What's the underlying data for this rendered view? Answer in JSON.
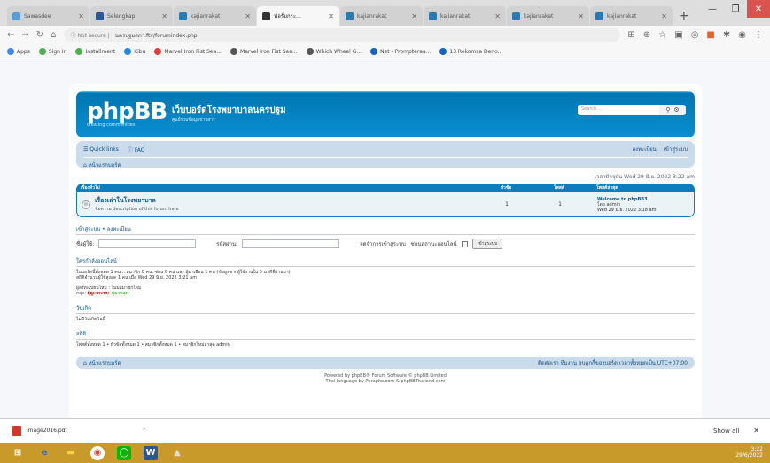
{
  "browser": {
    "tabs": [
      {
        "title": "Sawasdee",
        "color": "#5b9bd5"
      },
      {
        "title": "Selengkap",
        "color": "#2b5797"
      },
      {
        "title": "kajianrakat",
        "color": "#2a7ab0"
      },
      {
        "title": "ฟอรั่มกระ...",
        "color": "#333333",
        "active": true
      },
      {
        "title": "kajianrakat",
        "color": "#2a7ab0"
      },
      {
        "title": "kajianrakat",
        "color": "#2a7ab0"
      },
      {
        "title": "kajianrakat",
        "color": "#2a7ab0"
      },
      {
        "title": "kajianrakat",
        "color": "#2a7ab0"
      }
    ],
    "new_tab": "+",
    "address": "นครปฐมสภา.ftv/forumindex.php",
    "security": "ⓘ Not secure |",
    "bookmarks": [
      {
        "label": "Apps",
        "color": "#4285f4"
      },
      {
        "label": "Sign In",
        "color": "#4caf50"
      },
      {
        "label": "Installment",
        "color": "#4caf50"
      },
      {
        "label": "Kibu",
        "color": "#1e88e5"
      },
      {
        "label": "Marvel Iron Fist Sea...",
        "color": "#e53935"
      },
      {
        "label": "Marvel Iron Fist Sea...",
        "color": "#555555"
      },
      {
        "label": "Which Wheel G...",
        "color": "#555555"
      },
      {
        "label": "Net - Prompteraa...",
        "color": "#1565c0"
      },
      {
        "label": "13 Rekomsa Deno...",
        "color": "#1565c0"
      }
    ]
  },
  "forum": {
    "logo": "phpBB",
    "logo_tag": "creating communities",
    "site_name": "เว็บบอร์ดโรงพยาบาลนครปฐม",
    "site_desc": "ศูนย์รวมข้อมูลข่าวสาร",
    "search_placeholder": "Search…",
    "nav_faq": "Quick links",
    "nav_faq2": "FAQ",
    "nav_register": "ลงทะเบียน",
    "nav_login": "เข้าสู่ระบบ",
    "nav_board_index": "หน้าแรกบอร์ด",
    "timestamp": "เวลาปัจจุบัน Wed 29 มิ.ย. 2022 3:22 am",
    "table_head": {
      "forum": "เรื่องทั่วไป",
      "topics": "หัวข้อ",
      "posts": "โพสต์",
      "last": "โพสต์ล่าสุด"
    },
    "forum_title": "เรื่องเล่าในโรงพยาบาล",
    "forum_desc": "ข้อความ description of this forum here",
    "topics": "1",
    "posts": "1",
    "last_post_title": "Welcome to phpBB3",
    "last_post_by": "โดย admin",
    "last_post_date": "Wed 29 มิ.ย. 2022 3:18 am",
    "login_title": "เข้าสู่ระบบ • ลงทะเบียน",
    "username_label": "ชื่อผู้ใช้:",
    "password_label": "รหัสผ่าน:",
    "remember_label": "จดจำการเข้าสู่ระบบ | ซ่อนสถานะออนไลน์",
    "login_button": "เข้าสู่ระบบ",
    "online_title": "ใครกำลังออนไลน์",
    "online_text": "ในบอร์ดนี้ทั้งหมด 1 คน :: สมาชิก 0 คน, ซ่อน 0 คน และ ผู้มาเยือน 1 คน (ข้อมูลจากผู้ใช้งานใน 5 นาทีที่ผ่านมา)",
    "online_record": "สถิติจำนวนผู้ใช้สูงสุด 1 คน เมื่อ Wed 29 มิ.ย. 2022 3:21 am",
    "birthday_title": "ผู้ลงทะเบียนใหม่ : ไม่มีสมาชิกใหม่",
    "legend_label": "กลุ่ม:",
    "legend_admin": "ผู้ดูแลระบบ",
    "legend_mod": "ผู้ควบคุม",
    "birthdays_title": "วันเกิด",
    "birthdays_text": "ไม่มีวันเกิดวันนี้",
    "stats_title": "สถิติ",
    "stats_text": "โพสต์ทั้งหมด 1 • หัวข้อทั้งหมด 1 • สมาชิกทั้งหมด 1 • สมาชิกใหม่ล่าสุด admin",
    "footer_index": "หน้าแรกบอร์ด",
    "footer_right": "ติดต่อเรา  ทีมงาน  ลบคุกกี้ของบอร์ด  เวลาทั้งหมดเป็น UTC+07:00",
    "powered": "Powered by phpBB® Forum Software © phpBB Limited",
    "translated": "Thai language by Phrapho.com & phpBBThailand.com"
  },
  "download": {
    "file": "image2016.pdf",
    "show_all": "Show all",
    "close": "✕"
  },
  "taskbar": {
    "time": "3:22",
    "date": "29/6/2022"
  }
}
